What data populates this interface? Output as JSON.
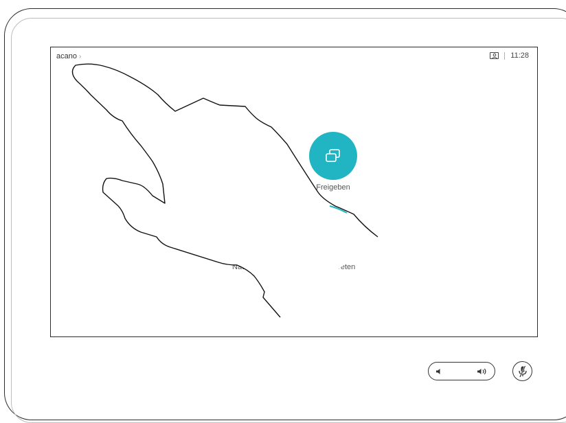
{
  "header": {
    "device_name": "acano",
    "time": "11:28"
  },
  "main": {
    "share_label": "Freigeben",
    "left_label": "Nac",
    "right_label": "..treten"
  },
  "icons": {
    "share": "share-screen-icon",
    "self_view": "self-view-icon",
    "volume_down": "volume-down-icon",
    "volume_up": "volume-up-icon",
    "mute": "microphone-mute-icon",
    "hand": "hand-gesture-icon"
  },
  "colors": {
    "accent": "#21b5c4",
    "outline": "#2a2a2a"
  }
}
